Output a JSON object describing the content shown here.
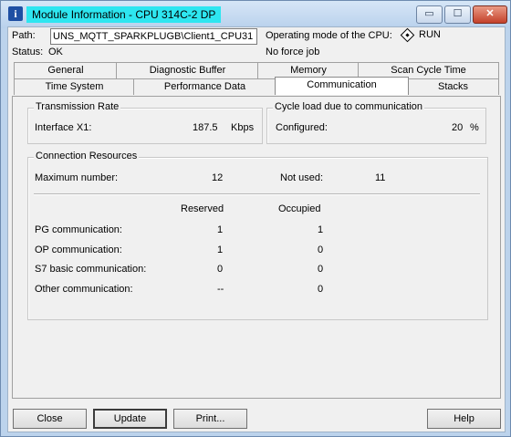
{
  "window": {
    "title": "Module Information - CPU 314C-2 DP",
    "app_icon": "i",
    "controls": {
      "minimize": "▭",
      "maximize": "☐",
      "close": "✕"
    }
  },
  "header": {
    "path_label": "Path:",
    "path_value": "UNS_MQTT_SPARKPLUGB\\Client1_CPU31",
    "status_label": "Status:",
    "status_value": "OK",
    "operating_mode_label": "Operating mode of the  CPU:",
    "operating_mode_value": "RUN",
    "force_job": "No force job"
  },
  "tabs": {
    "row1": [
      "General",
      "Diagnostic Buffer",
      "Memory",
      "Scan Cycle Time"
    ],
    "row2": [
      "Time System",
      "Performance Data",
      "Communication",
      "Stacks"
    ],
    "active": "Communication"
  },
  "transmission_rate": {
    "title": "Transmission Rate",
    "label": "Interface X1:",
    "value": "187.5",
    "unit": "Kbps"
  },
  "cycle_load": {
    "title": "Cycle load due to communication",
    "label": "Configured:",
    "value": "20",
    "unit": "%"
  },
  "connection_resources": {
    "title": "Connection Resources",
    "max_label": "Maximum number:",
    "max_value": "12",
    "not_used_label": "Not used:",
    "not_used_value": "11",
    "col_reserved": "Reserved",
    "col_occupied": "Occupied",
    "rows": [
      {
        "label": "PG communication:",
        "reserved": "1",
        "occupied": "1"
      },
      {
        "label": "OP communication:",
        "reserved": "1",
        "occupied": "0"
      },
      {
        "label": "S7 basic communication:",
        "reserved": "0",
        "occupied": "0"
      },
      {
        "label": "Other communication:",
        "reserved": "--",
        "occupied": "0"
      }
    ]
  },
  "buttons": {
    "close": "Close",
    "update": "Update",
    "print": "Print...",
    "help": "Help"
  },
  "colors": {
    "title_highlight": "#2ee6f0",
    "frame": "#bcd3ec",
    "panel_bg": "#f0f0f0"
  }
}
